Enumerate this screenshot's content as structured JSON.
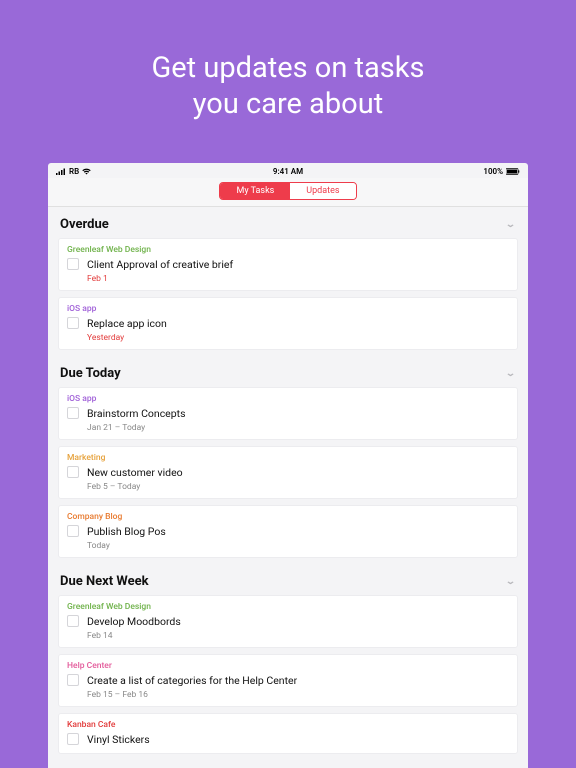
{
  "headline_line1": "Get updates on tasks",
  "headline_line2": "you care about",
  "statusbar": {
    "carrier": "RB",
    "time": "9:41 AM",
    "battery": "100%"
  },
  "tabs": {
    "my_tasks": "My Tasks",
    "updates": "Updates"
  },
  "sections": [
    {
      "title": "Overdue",
      "tasks": [
        {
          "project": "Greenleaf Web Design",
          "project_color": "c-green",
          "title": "Client Approval of creative brief",
          "date": "Feb 1",
          "date_red": true
        },
        {
          "project": "iOS app",
          "project_color": "c-purple",
          "title": "Replace app icon",
          "date": "Yesterday",
          "date_red": true
        }
      ]
    },
    {
      "title": "Due Today",
      "tasks": [
        {
          "project": "iOS app",
          "project_color": "c-purple",
          "title": "Brainstorm Concepts",
          "date": "Jan 21 – Today",
          "date_red": false
        },
        {
          "project": "Marketing",
          "project_color": "c-amber",
          "title": "New customer video",
          "date": "Feb 5 – Today",
          "date_red": false
        },
        {
          "project": "Company Blog",
          "project_color": "c-orange",
          "title": "Publish Blog Pos",
          "date": "Today",
          "date_red": false
        }
      ]
    },
    {
      "title": "Due Next Week",
      "tasks": [
        {
          "project": "Greenleaf Web Design",
          "project_color": "c-green",
          "title": "Develop Moodbords",
          "date": "Feb 14",
          "date_red": false
        },
        {
          "project": "Help Center",
          "project_color": "c-pink",
          "title": "Create a list of categories for the Help Center",
          "date": "Feb 15 – Feb 16",
          "date_red": false
        },
        {
          "project": "Kanban Cafe",
          "project_color": "c-red",
          "title": "Vinyl Stickers",
          "date": "",
          "date_red": false
        }
      ]
    }
  ]
}
